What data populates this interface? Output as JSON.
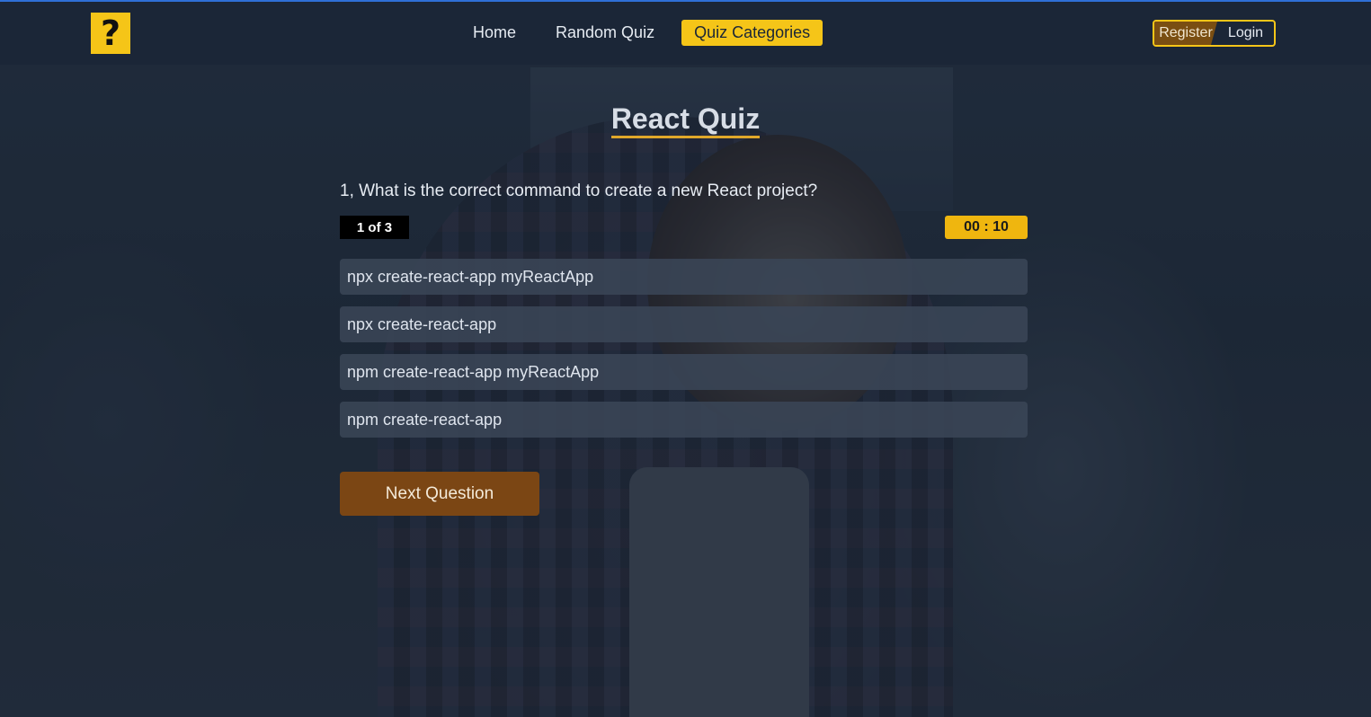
{
  "header": {
    "logo_glyph": "?",
    "nav": [
      {
        "label": "Home",
        "active": false
      },
      {
        "label": "Random Quiz",
        "active": false
      },
      {
        "label": "Quiz Categories",
        "active": true
      }
    ],
    "auth": {
      "register_label": "Register",
      "login_label": "Login"
    }
  },
  "quiz": {
    "title": "React Quiz",
    "question": "1, What is the correct command to create a new React project?",
    "progress": "1 of 3",
    "timer": "00 : 10",
    "options": [
      "npx create-react-app myReactApp",
      "npx create-react-app",
      "npm create-react-app myReactApp",
      "npm create-react-app"
    ],
    "next_label": "Next Question"
  },
  "colors": {
    "accent": "#f5c518",
    "timer": "#efb60f",
    "button": "#7b4614",
    "header_bg": "#1b2637"
  },
  "icons": {
    "logo": "question-mark-icon"
  }
}
